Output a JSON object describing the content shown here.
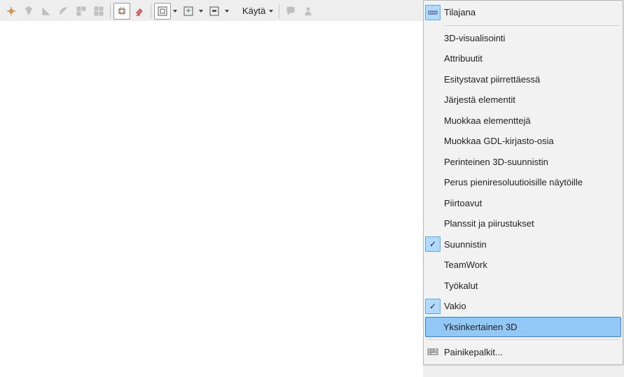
{
  "toolbar": {
    "text_button": "Käytä"
  },
  "menu": {
    "items": [
      {
        "label": "Tilajana"
      },
      {
        "label": "3D-visualisointi"
      },
      {
        "label": "Attribuutit"
      },
      {
        "label": "Esitystavat piirrettäessä"
      },
      {
        "label": "Järjestä elementit"
      },
      {
        "label": "Muokkaa elementtejä"
      },
      {
        "label": "Muokkaa GDL-kirjasto-osia"
      },
      {
        "label": "Perinteinen 3D-suunnistin"
      },
      {
        "label": "Perus pieniresoluutioisille näytöille"
      },
      {
        "label": "Piirtoavut"
      },
      {
        "label": "Planssit ja piirustukset"
      },
      {
        "label": "Suunnistin"
      },
      {
        "label": "TeamWork"
      },
      {
        "label": "Työkalut"
      },
      {
        "label": "Vakio"
      },
      {
        "label": "Yksinkertainen 3D"
      }
    ],
    "footer": "Painikepalkit..."
  }
}
